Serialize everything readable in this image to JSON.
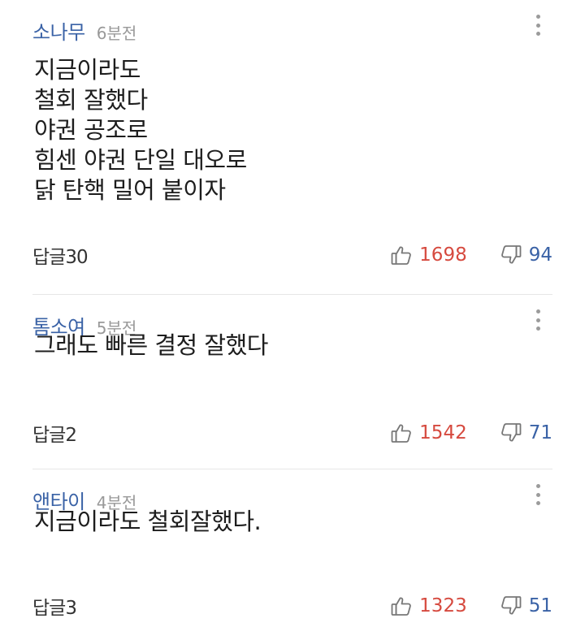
{
  "comments": [
    {
      "author": "소나무",
      "time": "6분전",
      "lines": [
        "지금이라도",
        "철회 잘했다",
        "야권 공조로",
        "힘센 야권 단일 대오로",
        "닭 탄핵 밀어 붙이자"
      ],
      "reply_label": "답글30",
      "likes": "1698",
      "dislikes": "94"
    },
    {
      "author": "톰소여",
      "time": "5분전",
      "lines": [
        "그래도 빠른 결정 잘했다"
      ],
      "reply_label": "답글2",
      "likes": "1542",
      "dislikes": "71"
    },
    {
      "author": "앤타이",
      "time": "4분전",
      "lines": [
        "지금이라도 철회잘했다."
      ],
      "reply_label": "답글3",
      "likes": "1323",
      "dislikes": "51"
    }
  ],
  "icons": {
    "more": "more-vertical-icon",
    "like": "thumbs-up-icon",
    "dislike": "thumbs-down-icon"
  },
  "colors": {
    "author": "#3a62a6",
    "like_count": "#d64a3f",
    "dislike_count": "#3a62a6",
    "time": "#999999"
  }
}
